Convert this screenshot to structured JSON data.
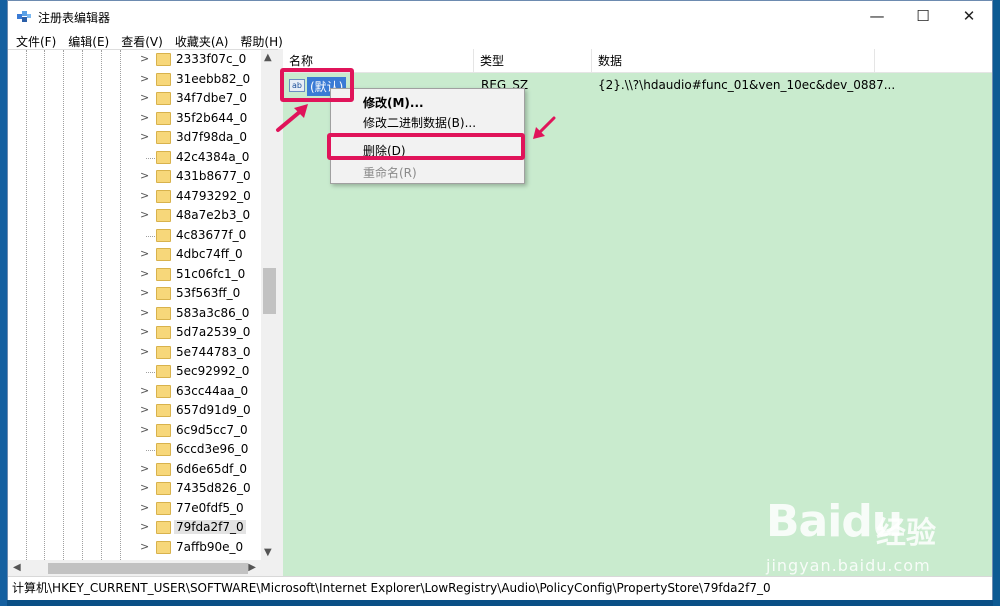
{
  "window": {
    "title": "注册表编辑器",
    "controls": {
      "minimize": "—",
      "maximize": "☐",
      "close": "✕"
    }
  },
  "menubar": [
    "文件(F)",
    "编辑(E)",
    "查看(V)",
    "收藏夹(A)",
    "帮助(H)"
  ],
  "tree": {
    "items": [
      {
        "label": "2333f07c_0",
        "expandable": true
      },
      {
        "label": "31eebb82_0",
        "expandable": true
      },
      {
        "label": "34f7dbe7_0",
        "expandable": true
      },
      {
        "label": "35f2b644_0",
        "expandable": true
      },
      {
        "label": "3d7f98da_0",
        "expandable": true
      },
      {
        "label": "42c4384a_0",
        "expandable": false
      },
      {
        "label": "431b8677_0",
        "expandable": true
      },
      {
        "label": "44793292_0",
        "expandable": true
      },
      {
        "label": "48a7e2b3_0",
        "expandable": true
      },
      {
        "label": "4c83677f_0",
        "expandable": false
      },
      {
        "label": "4dbc74ff_0",
        "expandable": true
      },
      {
        "label": "51c06fc1_0",
        "expandable": true
      },
      {
        "label": "53f563ff_0",
        "expandable": true
      },
      {
        "label": "583a3c86_0",
        "expandable": true
      },
      {
        "label": "5d7a2539_0",
        "expandable": true
      },
      {
        "label": "5e744783_0",
        "expandable": true
      },
      {
        "label": "5ec92992_0",
        "expandable": false
      },
      {
        "label": "63cc44aa_0",
        "expandable": true
      },
      {
        "label": "657d91d9_0",
        "expandable": true
      },
      {
        "label": "6c9d5cc7_0",
        "expandable": true
      },
      {
        "label": "6ccd3e96_0",
        "expandable": false
      },
      {
        "label": "6d6e65df_0",
        "expandable": true
      },
      {
        "label": "7435d826_0",
        "expandable": true
      },
      {
        "label": "77e0fdf5_0",
        "expandable": true
      },
      {
        "label": "79fda2f7_0",
        "expandable": true,
        "selected": true
      },
      {
        "label": "7affb90e_0",
        "expandable": true
      }
    ]
  },
  "values": {
    "columns": {
      "name": "名称",
      "type": "类型",
      "data": "数据"
    },
    "row": {
      "icon": "ab",
      "name": "(默认)",
      "type": "REG_SZ",
      "data": "{2}.\\\\?\\hdaudio#func_01&ven_10ec&dev_0887..."
    }
  },
  "context_menu": {
    "modify": "修改(M)...",
    "modify_binary": "修改二进制数据(B)...",
    "delete": "删除(D)",
    "rename": "重命名(R)"
  },
  "statusbar": {
    "path": "计算机\\HKEY_CURRENT_USER\\SOFTWARE\\Microsoft\\Internet Explorer\\LowRegistry\\Audio\\PolicyConfig\\PropertyStore\\79fda2f7_0"
  },
  "watermark": {
    "logo": "Bai",
    "logo_du": "du",
    "jingyan": "经验",
    "url": "jingyan.baidu.com"
  },
  "colors": {
    "highlight": "#e0145a",
    "value_pane": "#c9ebce",
    "selection": "#3a7bd5"
  }
}
